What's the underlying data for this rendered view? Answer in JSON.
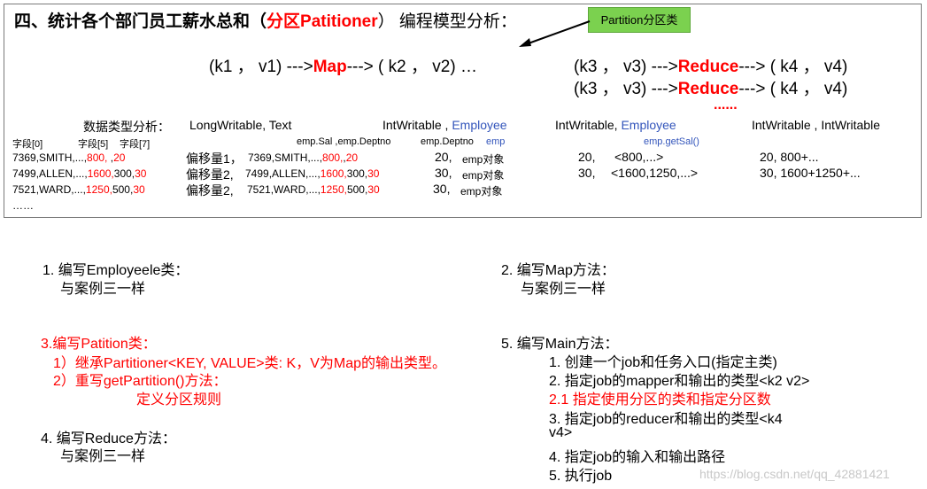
{
  "title": {
    "prefix": "四、统计各个部门员工薪水总和（",
    "highlight": "分区Patitioner",
    "suffix": "） 编程模型分析："
  },
  "callout": {
    "label": "Partition分区类"
  },
  "flow": {
    "map_left": "(k1   ，   v1) --->",
    "map_word": "Map",
    "map_right": "---> ( k2   ，  v2)   …",
    "line1_left": "(k3   ，   v3) --->",
    "line1_reduce": "Reduce",
    "line1_right": "---> ( k4   ，   v4)",
    "line2_left": "(k3   ，   v3) --->",
    "line2_reduce": "Reduce",
    "line2_right": "---> ( k4   ，   v4)",
    "dots": "......"
  },
  "types": {
    "label": "数据类型分析：",
    "t1": "LongWritable,  Text",
    "t2_a": "IntWritable    ,",
    "t2_b": "Employee",
    "t3_a": "IntWritable,",
    "t3_b": "Employee",
    "t4": "IntWritable ,   IntWritable"
  },
  "fields": {
    "f0": "字段[0]",
    "f5": "字段[5]",
    "f7": "字段[7]",
    "empsal": "emp.Sal ,emp.Deptno",
    "empdeptno": "emp.Deptno",
    "emp": "emp",
    "getsal": "emp.getSal()"
  },
  "rows": [
    {
      "raw_a": "7369,SMITH,...,",
      "raw_b": "800,",
      "raw_c": "   ,",
      "raw_d": "20",
      "offset": "偏移量1，",
      "m_a": "7369,SMITH,...,",
      "m_b": "800,",
      "m_c": ",",
      "m_d": "20",
      "k2": "20,",
      "v2": "emp对象",
      "k3": "20,",
      "v3": "<800,...>",
      "out": "20,  800+..."
    },
    {
      "raw_a": "7499,ALLEN,...,",
      "raw_b": "1600,",
      "raw_c": "300,",
      "raw_d": "30",
      "offset": "偏移量2,",
      "m_a": "7499,ALLEN,...,",
      "m_b": "1600,",
      "m_c": "300,",
      "m_d": "30",
      "k2": "30,",
      "v2": "emp对象",
      "k3": "30,",
      "v3": "<1600,1250,...>",
      "out": "30, 1600+1250+..."
    },
    {
      "raw_a": "7521,WARD,...,",
      "raw_b": "1250,",
      "raw_c": "500,",
      "raw_d": "30",
      "offset": "偏移量2,",
      "m_a": "7521,WARD,...,",
      "m_b": "1250,",
      "m_c": "500,",
      "m_d": "30",
      "k2": "30,",
      "v2": "emp对象"
    }
  ],
  "ellipsis": "……",
  "steps": {
    "s1_title": "1. 编写Employeele类：",
    "s1_body": "与案例三一样",
    "s2_title": "2. 编写Map方法：",
    "s2_body": "与案例三一样",
    "s3_title": "3.编写Patition类：",
    "s3_l1": "1）继承Partitioner<KEY, VALUE>类: K，V为Map的输出类型。",
    "s3_l2": "2）重写getPartition()方法：",
    "s3_l3": "定义分区规则",
    "s4_title": "4. 编写Reduce方法：",
    "s4_body": "与案例三一样",
    "s5_title": "5. 编写Main方法：",
    "s5_items": [
      "1. 创建一个job和任务入口(指定主类)",
      "2. 指定job的mapper和输出的类型<k2 v2>",
      "2.1 指定使用分区的类和指定分区数",
      "3. 指定job的reducer和输出的类型<k4",
      "v4>",
      "4. 指定job的输入和输出路径",
      "5. 执行job"
    ]
  },
  "watermark": "https://blog.csdn.net/qq_42881421",
  "colors": {
    "accent_red": "#ff0000",
    "type_blue": "#3355bb",
    "callout_green": "#7bd14f"
  }
}
